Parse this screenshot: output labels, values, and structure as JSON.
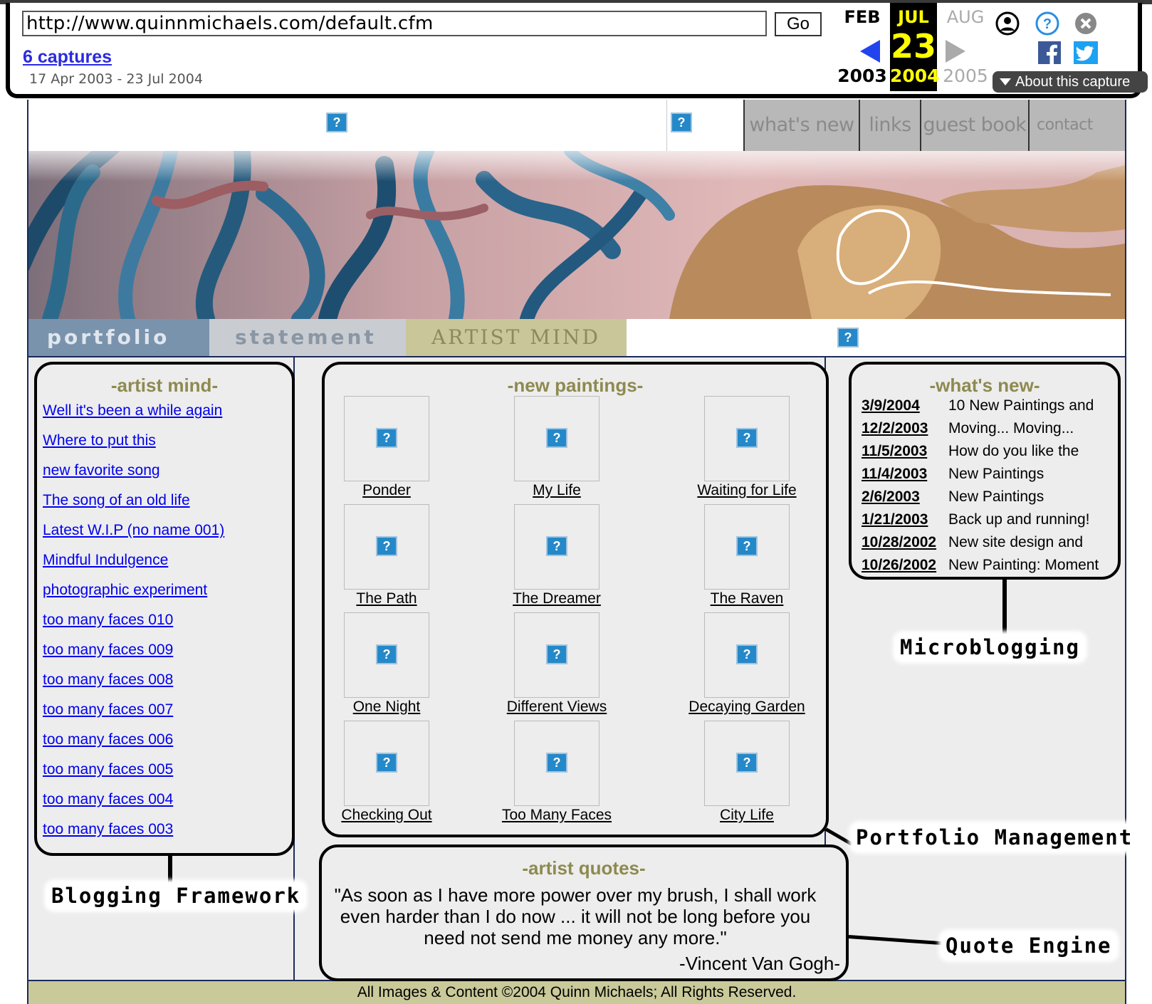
{
  "wayback": {
    "url": "http://www.quinnmichaels.com/default.cfm",
    "go_label": "Go",
    "captures_label": "6 captures",
    "date_range": "17 Apr 2003 - 23 Jul 2004",
    "prev_month": "FEB",
    "cur_month": "JUL",
    "next_month": "AUG",
    "cur_day": "23",
    "prev_year": "2003",
    "cur_year": "2004",
    "next_year": "2005",
    "about_label": "About this capture",
    "icons": [
      "user-icon",
      "help-icon",
      "close-icon",
      "facebook-icon",
      "twitter-icon"
    ]
  },
  "site": {
    "top_nav": [
      "what's new",
      "links",
      "guest book",
      "contact"
    ],
    "section_tabs": [
      "portfolio",
      "statement",
      "ARTIST MIND"
    ],
    "broken_image_glyph": "?"
  },
  "artist_mind": {
    "heading": "-artist mind-",
    "items": [
      "Well it's been a while again",
      "Where to put this",
      "new favorite song",
      "The song of an old life",
      "Latest W.I.P (no name 001)",
      "Mindful Indulgence",
      "photographic experiment",
      "too many faces 010",
      "too many faces 009",
      "too many faces 008",
      "too many faces 007",
      "too many faces 006",
      "too many faces 005",
      "too many faces 004",
      "too many faces 003"
    ]
  },
  "new_paintings": {
    "heading": "-new paintings-",
    "items": [
      "Ponder",
      "My Life",
      "Waiting for Life",
      "The Path",
      "The Dreamer",
      "The Raven",
      "One Night",
      "Different Views",
      "Decaying Garden",
      "Checking Out",
      "Too Many Faces",
      "City Life"
    ]
  },
  "whats_new": {
    "heading": "-what's new-",
    "items": [
      {
        "date": "3/9/2004",
        "text": "10 New Paintings and"
      },
      {
        "date": "12/2/2003",
        "text": "Moving... Moving..."
      },
      {
        "date": "11/5/2003",
        "text": "How do you like the"
      },
      {
        "date": "11/4/2003",
        "text": "New Paintings"
      },
      {
        "date": "2/6/2003",
        "text": "New Paintings"
      },
      {
        "date": "1/21/2003",
        "text": "Back up and running!"
      },
      {
        "date": "10/28/2002",
        "text": "New site design and"
      },
      {
        "date": "10/26/2002",
        "text": "New Painting: Moment"
      }
    ]
  },
  "artist_quotes": {
    "heading": "-artist quotes-",
    "quote": "\"As soon as I have more power over my brush, I shall work even harder than I do now ... it will not be long before you need not send me money any more.\"",
    "author": "-Vincent Van Gogh-"
  },
  "footer": "All Images & Content ©2004 Quinn Michaels; All Rights Reserved.",
  "annotations": {
    "blogging": "Blogging Framework",
    "microblogging": "Microblogging",
    "portfolio": "Portfolio Management",
    "quote": "Quote Engine"
  },
  "colors": {
    "accent_olive": "#8e8a50",
    "footer_bg": "#c9c99a",
    "wayback_highlight": "#ffff00",
    "wayback_link": "#2a2ae0"
  }
}
